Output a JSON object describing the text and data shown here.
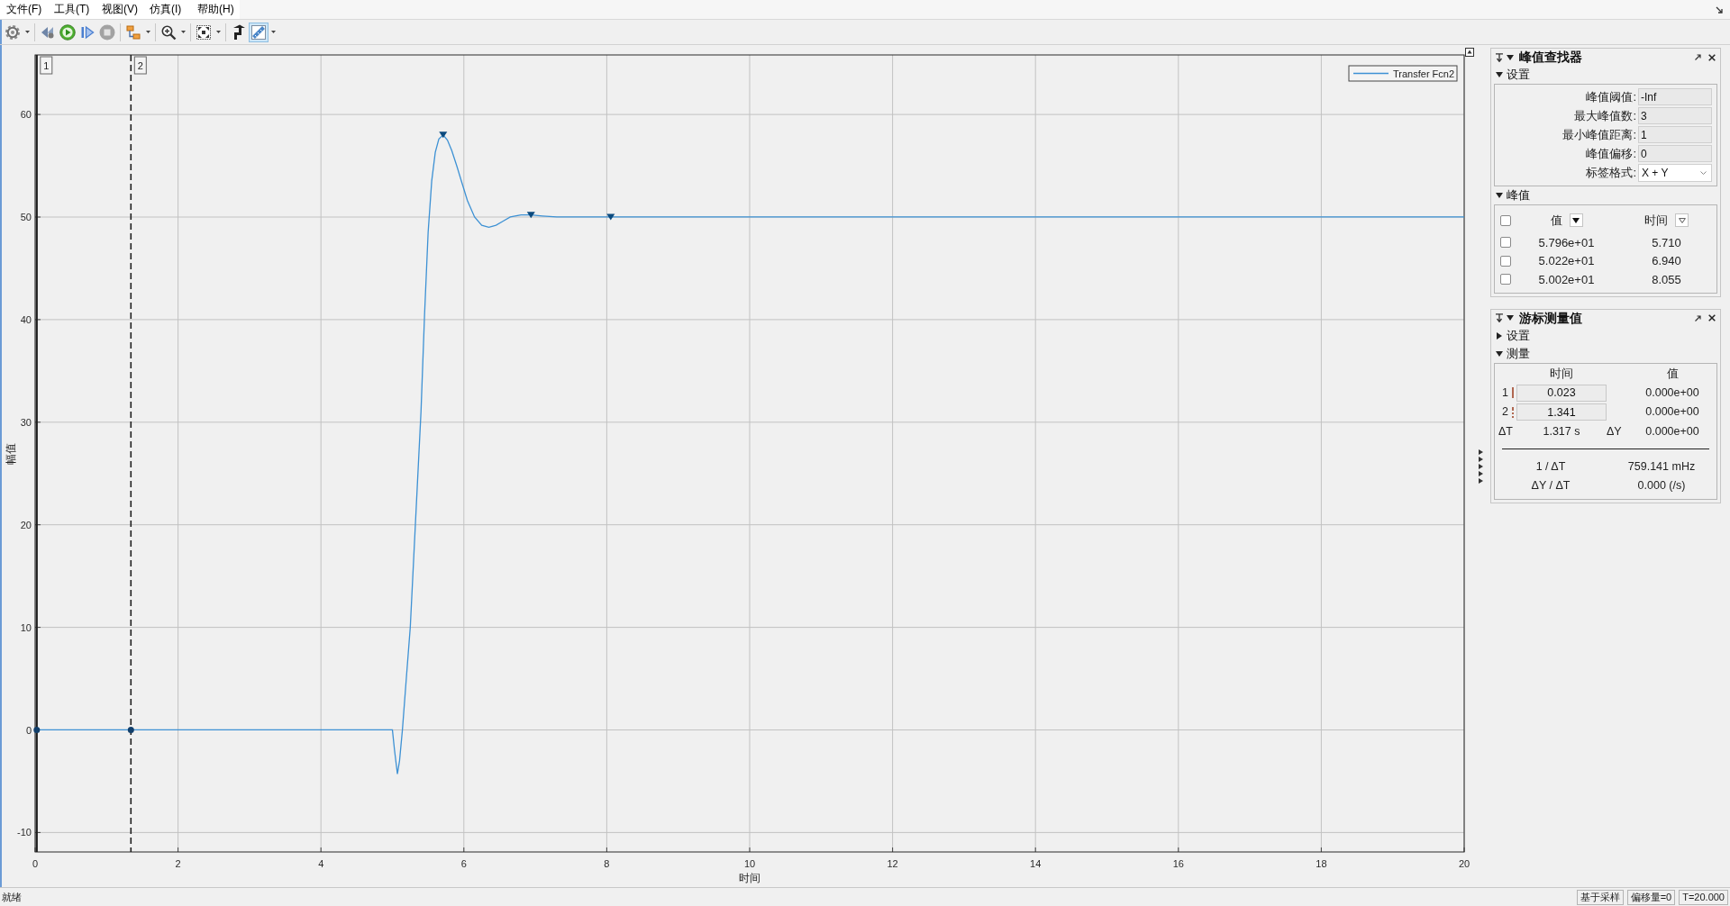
{
  "menu": [
    "文件(F)",
    "工具(T)",
    "视图(V)",
    "仿真(I)",
    "帮助(H)"
  ],
  "toolbar": [
    {
      "pressed": false,
      "disabled": false
    },
    {
      "pressed": false,
      "disabled": false
    },
    {
      "pressed": false,
      "disabled": false
    },
    {
      "pressed": false,
      "disabled": false
    },
    {
      "pressed": false,
      "disabled": true
    },
    {
      "pressed": false,
      "disabled": false
    },
    {
      "pressed": false,
      "disabled": false
    },
    {
      "pressed": false,
      "disabled": false
    },
    {
      "pressed": false,
      "disabled": false
    },
    {
      "pressed": true,
      "disabled": false
    }
  ],
  "plot": {
    "chart_data": {
      "type": "line",
      "xlabel": "时间",
      "ylabel": "幅值",
      "xlim": [
        0,
        20
      ],
      "ylim": [
        -11.9,
        65.8
      ],
      "xticks": [
        0,
        2,
        4,
        6,
        8,
        10,
        12,
        14,
        16,
        18,
        20
      ],
      "yticks": [
        -10,
        0,
        10,
        20,
        30,
        40,
        50,
        60
      ],
      "grid": true,
      "legend": "top-right",
      "series": [
        {
          "name": "Transfer Fcn2",
          "color": "#3d91d4",
          "x": [
            0,
            5,
            5.03,
            5.07,
            5.1,
            5.14,
            5.2,
            5.25,
            5.3,
            5.35,
            5.4,
            5.45,
            5.5,
            5.55,
            5.6,
            5.65,
            5.71,
            5.77,
            5.83,
            5.9,
            5.97,
            6.05,
            6.15,
            6.25,
            6.35,
            6.45,
            6.55,
            6.65,
            6.8,
            6.94,
            7.1,
            7.3,
            7.6,
            8.055,
            9,
            20
          ],
          "values": [
            0,
            0,
            -2,
            -4.3,
            -3,
            0,
            5.5,
            10,
            17,
            24,
            31,
            40.5,
            48.5,
            53.5,
            56.3,
            57.6,
            58,
            57.5,
            56.5,
            55,
            53.4,
            51.6,
            50,
            49.2,
            49,
            49.2,
            49.6,
            50,
            50.2,
            50.2,
            50.1,
            50,
            50,
            50,
            50,
            50
          ]
        },
        {
          "type": "scatter",
          "marker": "triangle-down",
          "color": "#0b4a7e",
          "x": [
            5.71,
            6.94,
            8.055
          ],
          "values": [
            58,
            50.2,
            50
          ]
        },
        {
          "type": "scatter",
          "marker": "circle",
          "color": "#123f6b",
          "x": [
            0.023,
            1.341
          ],
          "values": [
            0,
            0
          ]
        }
      ],
      "ref_lines": [
        {
          "axis": "x",
          "value": 0.023,
          "color": "#1f1f1f",
          "line_style": "solid"
        },
        {
          "axis": "x",
          "value": 1.341,
          "color": "#1f1f1f",
          "line_style": "dashed"
        }
      ]
    },
    "cursor_labels": [
      "1",
      "2"
    ]
  },
  "peak_finder": {
    "title": "峰值查找器",
    "expanded": true,
    "settings": {
      "label": "设置",
      "expanded": true,
      "fields": [
        {
          "label": "峰值阈值:",
          "value": "-Inf",
          "kind": "text"
        },
        {
          "label": "最大峰值数:",
          "value": "3",
          "kind": "text"
        },
        {
          "label": "最小峰值距离:",
          "value": "1",
          "kind": "text"
        },
        {
          "label": "峰值偏移:",
          "value": "0",
          "kind": "text"
        },
        {
          "label": "标签格式:",
          "value": "X + Y",
          "kind": "dropdown"
        }
      ]
    },
    "peaks": {
      "label": "峰值",
      "expanded": true,
      "select_all": {
        "checked": false
      },
      "columns": [
        {
          "label": "值",
          "sorted": true
        },
        {
          "label": "时间",
          "sorted": false
        }
      ],
      "rows": [
        {
          "checked": false,
          "value": "5.796e+01",
          "time": "5.710"
        },
        {
          "checked": false,
          "value": "5.022e+01",
          "time": "6.940"
        },
        {
          "checked": false,
          "value": "5.002e+01",
          "time": "8.055"
        }
      ]
    }
  },
  "cursor_measurements": {
    "title": "游标测量值",
    "expanded": true,
    "settings": {
      "label": "设置",
      "expanded": false
    },
    "measurements": {
      "label": "测量",
      "expanded": true,
      "columns": [
        "时间",
        "值"
      ],
      "cursors": [
        {
          "number": "1",
          "kind": "solid",
          "time": "0.023",
          "value": "0.000e+00"
        },
        {
          "number": "2",
          "kind": "dashed",
          "time": "1.341",
          "value": "0.000e+00"
        }
      ],
      "delta_t_label": "ΔT",
      "delta_t": "1.317 s",
      "delta_y_label": "ΔY",
      "delta_y": "0.000e+00",
      "derived": [
        {
          "label": "1 / ΔT",
          "value": "759.141 mHz"
        },
        {
          "label": "ΔY / ΔT",
          "value": "0.000 (/s)"
        }
      ]
    }
  },
  "status_bar": {
    "text": "就绪",
    "cells": [
      "基于采样",
      "偏移量=0",
      "T=20.000"
    ]
  }
}
